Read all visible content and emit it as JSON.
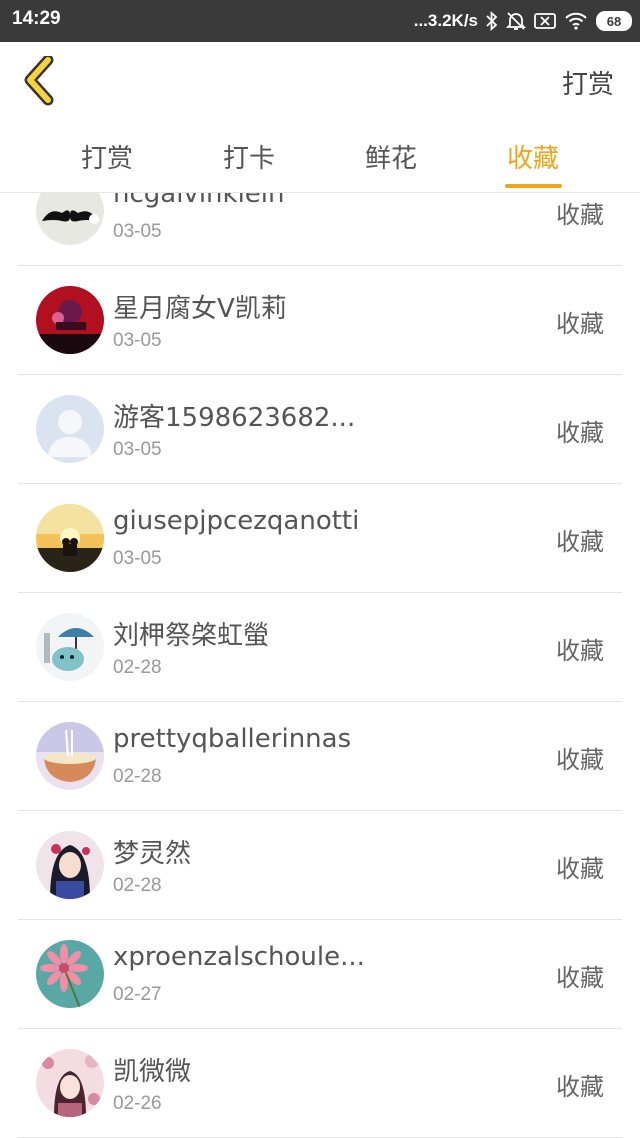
{
  "status_bar": {
    "time": "14:29",
    "network_speed": "...3.2K/s",
    "battery": "68",
    "icons": [
      "bluetooth-icon",
      "mute-icon",
      "sim-off-icon",
      "wifi-icon",
      "battery-icon"
    ]
  },
  "header": {
    "back_icon": "chevron-left-icon",
    "action_label": "打赏"
  },
  "colors": {
    "accent": "#f0a51c",
    "status_bar_bg": "#3a3a3a",
    "text_primary": "#555555",
    "text_secondary": "#999999"
  },
  "tabs": [
    {
      "label": "打赏",
      "active": false
    },
    {
      "label": "打卡",
      "active": false
    },
    {
      "label": "鲜花",
      "active": false
    },
    {
      "label": "收藏",
      "active": true
    }
  ],
  "list": {
    "items": [
      {
        "name": "ncgalvinklein",
        "date": "03-05",
        "action": "收藏",
        "avatar": "mustache-avatar"
      },
      {
        "name": "星月腐女V凯莉",
        "date": "03-05",
        "action": "收藏",
        "avatar": "red-anime-avatar"
      },
      {
        "name": "游客1598623682...",
        "date": "03-05",
        "action": "收藏",
        "avatar": "default-user-avatar"
      },
      {
        "name": "giusepjpcezqanotti",
        "date": "03-05",
        "action": "收藏",
        "avatar": "sunset-couple-avatar"
      },
      {
        "name": "刘柙祭棨虹螢",
        "date": "02-28",
        "action": "收藏",
        "avatar": "umbrella-cat-avatar"
      },
      {
        "name": "prettyqballerinnas",
        "date": "02-28",
        "action": "收藏",
        "avatar": "noodle-bowl-avatar"
      },
      {
        "name": "梦灵然",
        "date": "02-28",
        "action": "收藏",
        "avatar": "anime-girl-avatar"
      },
      {
        "name": "xproenzalschoule...",
        "date": "02-27",
        "action": "收藏",
        "avatar": "pink-flower-avatar"
      },
      {
        "name": "凯微微",
        "date": "02-26",
        "action": "收藏",
        "avatar": "floral-girl-avatar"
      }
    ]
  }
}
